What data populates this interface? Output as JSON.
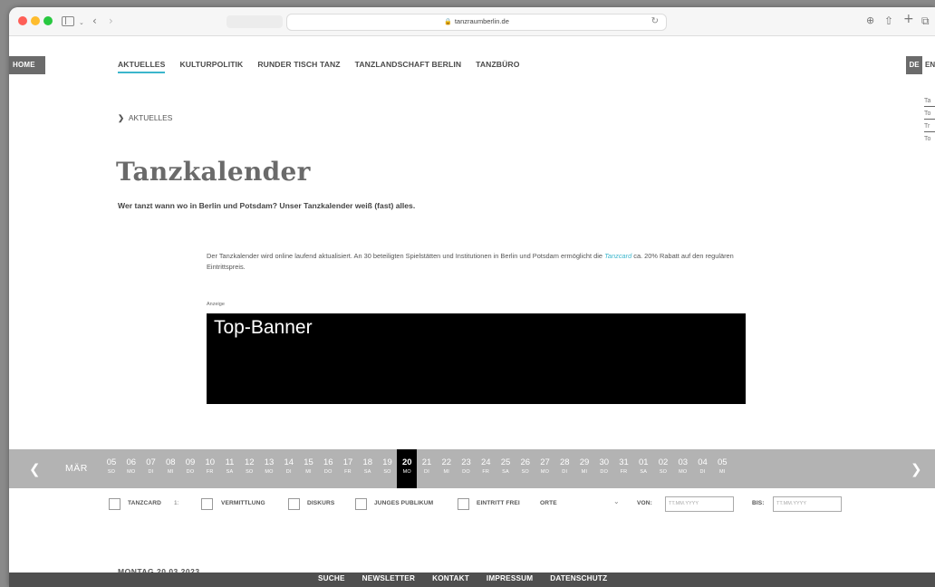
{
  "browser": {
    "url": "tanzraumberlin.de",
    "lock_icon": "🔒",
    "reload_icon": "↻",
    "back_icon": "‹",
    "forward_icon": "›",
    "download_icon": "⊕",
    "share_icon": "⇧",
    "new_tab_icon": "+",
    "tabs_icon": "⧉"
  },
  "nav": {
    "home": "HOME",
    "items": [
      "AKTUELLES",
      "KULTURPOLITIK",
      "RUNDER TISCH TANZ",
      "TANZLANDSCHAFT BERLIN",
      "TANZBÜRO"
    ],
    "lang_de": "DE",
    "lang_en": "EN"
  },
  "side_widget": [
    "Ta",
    "To",
    "Tr",
    "To"
  ],
  "breadcrumb": {
    "chevron": "❯",
    "label": "AKTUELLES"
  },
  "page": {
    "title": "Tanzkalender",
    "subtitle": "Wer tanzt wann wo in Berlin und Potsdam? Unser Tanzkalender weiß (fast) alles.",
    "intro_before": "Der Tanzkalender wird online laufend aktualisiert. An 30 beteiligten Spielstätten und Institutionen in Berlin und Potsdam ermöglicht die ",
    "intro_link": "Tanzcard",
    "intro_after": " ca. 20% Rabatt auf den regulären Eintrittspreis."
  },
  "ad": {
    "label": "Anzeige",
    "banner_text": "Top-Banner"
  },
  "calendar": {
    "prev": "❮",
    "next": "❯",
    "month": "MÄR",
    "days": [
      {
        "num": "05",
        "dow": "SO"
      },
      {
        "num": "06",
        "dow": "MO"
      },
      {
        "num": "07",
        "dow": "DI"
      },
      {
        "num": "08",
        "dow": "MI"
      },
      {
        "num": "09",
        "dow": "DO"
      },
      {
        "num": "10",
        "dow": "FR"
      },
      {
        "num": "11",
        "dow": "SA"
      },
      {
        "num": "12",
        "dow": "SO"
      },
      {
        "num": "13",
        "dow": "MO"
      },
      {
        "num": "14",
        "dow": "DI"
      },
      {
        "num": "15",
        "dow": "MI"
      },
      {
        "num": "16",
        "dow": "DO"
      },
      {
        "num": "17",
        "dow": "FR"
      },
      {
        "num": "18",
        "dow": "SA"
      },
      {
        "num": "19",
        "dow": "SO"
      },
      {
        "num": "20",
        "dow": "MO"
      },
      {
        "num": "21",
        "dow": "DI"
      },
      {
        "num": "22",
        "dow": "MI"
      },
      {
        "num": "23",
        "dow": "DO"
      },
      {
        "num": "24",
        "dow": "FR"
      },
      {
        "num": "25",
        "dow": "SA"
      },
      {
        "num": "26",
        "dow": "SO"
      },
      {
        "num": "27",
        "dow": "MO"
      },
      {
        "num": "28",
        "dow": "DI"
      },
      {
        "num": "29",
        "dow": "MI"
      },
      {
        "num": "30",
        "dow": "DO"
      },
      {
        "num": "31",
        "dow": "FR"
      },
      {
        "num": "01",
        "dow": "SA"
      },
      {
        "num": "02",
        "dow": "SO"
      },
      {
        "num": "03",
        "dow": "MO"
      },
      {
        "num": "04",
        "dow": "DI"
      },
      {
        "num": "05",
        "dow": "MI"
      }
    ],
    "selected_day": "20"
  },
  "filters": {
    "tanzcard": "TANZCARD",
    "tanzcard_suffix": "1:",
    "vermittlung": "VERMITTLUNG",
    "diskurs": "DISKURS",
    "junges_publikum": "JUNGES PUBLIKUM",
    "eintritt_frei": "EINTRITT FREI",
    "orte": "ORTE",
    "orte_chevron": "⌄",
    "von": "VON:",
    "bis": "BIS:",
    "date_placeholder": "TT.MM.YYYY"
  },
  "list_heading": "MONTAG 20.03.2023",
  "footer": [
    "SUCHE",
    "NEWSLETTER",
    "KONTAKT",
    "IMPRESSUM",
    "DATENSCHUTZ"
  ]
}
